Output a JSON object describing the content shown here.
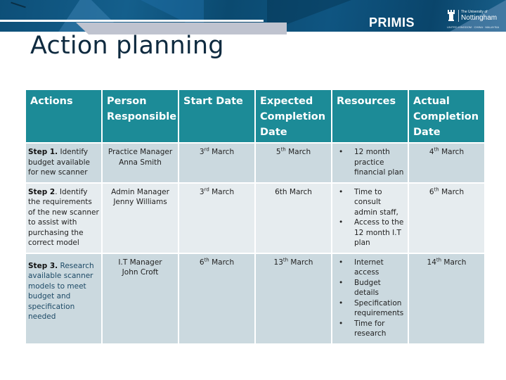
{
  "header": {
    "brand": "PRIMIS",
    "university_line1": "The University of",
    "university_line2": "Nottingham",
    "university_line3": "UNITED KINGDOM · CHINA · MALAYSIA",
    "logo_icon": "castle-tower-icon"
  },
  "page_title": "Action planning",
  "table": {
    "columns": [
      "Actions",
      "Person Responsible",
      "Start Date",
      "Expected Completion Date",
      "Resources",
      "Actual Completion Date"
    ],
    "rows": [
      {
        "step_label": "Step 1.",
        "description": " Identify budget available for new scanner",
        "person_role": "Practice Manager",
        "person_name": "Anna Smith",
        "start_day": "3",
        "start_suffix": "rd",
        "start_month": " March",
        "expected_day": "5",
        "expected_suffix": "th",
        "expected_month": " March",
        "resources": [
          "12 month practice financial plan"
        ],
        "actual_day": "4",
        "actual_suffix": "th",
        "actual_month": " March"
      },
      {
        "step_label": "Step 2",
        "description": ". Identify the requirements of the new  scanner to assist with purchasing the correct model",
        "person_role": "Admin Manager",
        "person_name": "Jenny Williams",
        "start_day": "3",
        "start_suffix": "rd",
        "start_month": " March",
        "expected_day": "6th March",
        "expected_suffix": "",
        "expected_month": "",
        "resources": [
          "Time to consult admin staff,",
          "Access to the 12 month I.T plan"
        ],
        "actual_day": "6",
        "actual_suffix": "th",
        "actual_month": " March"
      },
      {
        "step_label": "Step 3.",
        "description": " Research available scanner models to meet budget and specification needed",
        "person_role": "I.T Manager",
        "person_name": "John Croft",
        "start_day": "6",
        "start_suffix": "th",
        "start_month": " March",
        "expected_day": "13",
        "expected_suffix": "th",
        "expected_month": " March",
        "resources": [
          "Internet access",
          "Budget details",
          "Specification requirements",
          "Time for research"
        ],
        "actual_day": "14",
        "actual_suffix": "th",
        "actual_month": " March"
      }
    ]
  },
  "colors": {
    "header_teal": "#1c8b97",
    "banner_blue": "#0d4f78",
    "row_dark": "#cbd9df",
    "row_light": "#e6ecef",
    "title_color": "#0e2a3f"
  }
}
